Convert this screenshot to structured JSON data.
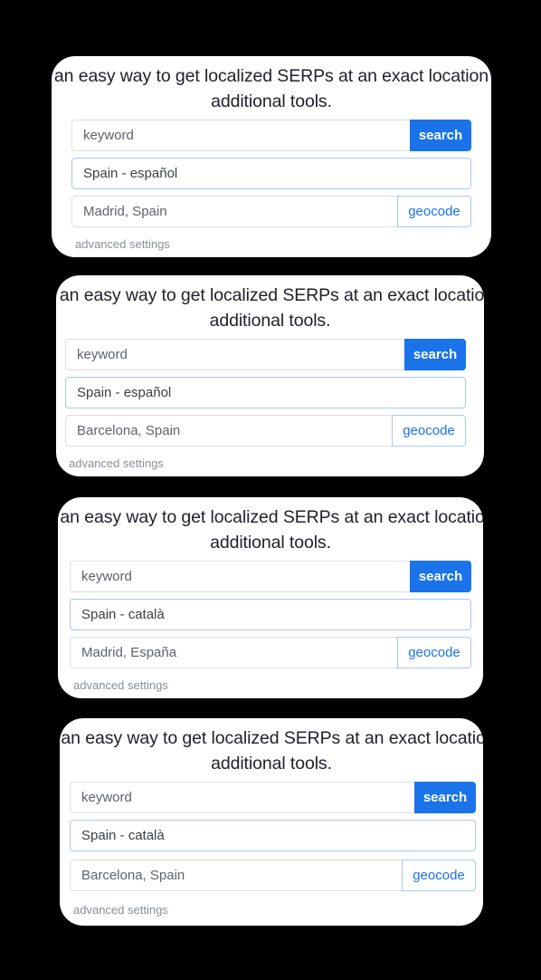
{
  "background_color": "#000000",
  "theme": {
    "accent_blue": "#1a73e8",
    "field_border": "#dcdfe3",
    "focus_border": "#a8c7f0",
    "card_bg": "#ffffff",
    "muted_text": "#8a8f98"
  },
  "intro": {
    "line1": "is an easy way to get localized SERPs at an exact location w",
    "line2": "additional tools."
  },
  "labels": {
    "search_button": "search",
    "geocode_button": "geocode",
    "advanced_settings": "advanced settings",
    "keyword_placeholder": "keyword"
  },
  "cards": [
    {
      "id": "card-1",
      "intro_line1": "is an easy way to get localized SERPs at an exact location w",
      "intro_line2": "additional tools.",
      "keyword_value": "",
      "keyword_placeholder": "keyword",
      "search_label": "search",
      "language": "Spain - español",
      "location": "Madrid, Spain",
      "geocode_label": "geocode",
      "advanced_label": "advanced settings"
    },
    {
      "id": "card-2",
      "intro_line1": "s an easy way to get localized SERPs at an exact location",
      "intro_line2": "additional tools.",
      "keyword_value": "",
      "keyword_placeholder": "keyword",
      "search_label": "search",
      "language": "Spain - español",
      "location": "Barcelona, Spain",
      "geocode_label": "geocode",
      "advanced_label": "advanced settings"
    },
    {
      "id": "card-3",
      "intro_line1": "s an easy way to get localized SERPs at an exact location",
      "intro_line2": "additional tools.",
      "keyword_value": "",
      "keyword_placeholder": "keyword",
      "search_label": "search",
      "language": "Spain - català",
      "location": "Madrid, España",
      "geocode_label": "geocode",
      "advanced_label": "advanced settings"
    },
    {
      "id": "card-4",
      "intro_line1": "s an easy way to get localized SERPs at an exact location",
      "intro_line2": "additional tools.",
      "keyword_value": "",
      "keyword_placeholder": "keyword",
      "search_label": "search",
      "language": "Spain - català",
      "location": "Barcelona, Spain",
      "geocode_label": "geocode",
      "advanced_label": "advanced settings"
    }
  ]
}
